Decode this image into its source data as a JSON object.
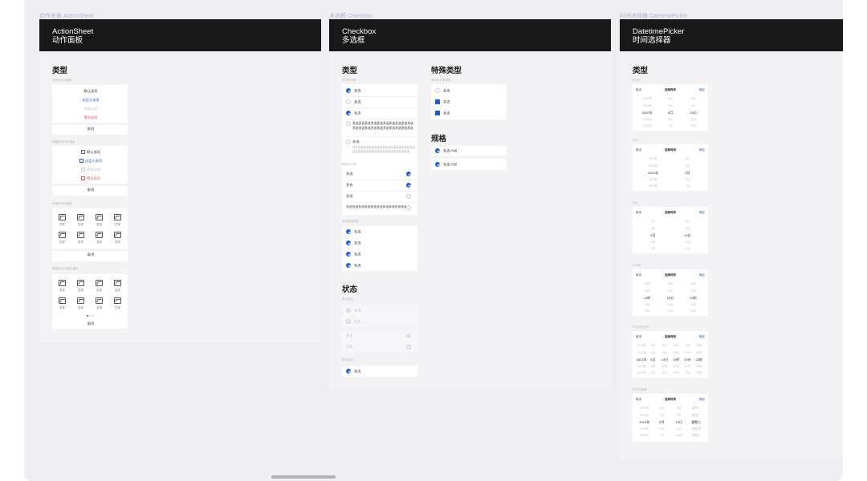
{
  "captions": {
    "actionsheet": "动作面板 ActionSheet",
    "checkbox": "多选框 Checkbox",
    "datetime": "时间选择器 DatetimePicker"
  },
  "actionsheet": {
    "header_en": "ActionSheet",
    "header_cn": "动作面板",
    "section_type": "类型",
    "list_label": "列表型动作面板",
    "list_items": [
      "默认选项",
      "自定义选项",
      "失效选项",
      "警告选项"
    ],
    "cancel": "取消",
    "icon_list_label": "带图标的动作面板",
    "icon_items": [
      "默认选项",
      "自定义选项",
      "失效选项",
      "警告选项"
    ],
    "grid_label": "宫格型动作面板",
    "grid_text": "文字",
    "grid_pager_label": "宫格型动作面板-翻页"
  },
  "checkbox": {
    "header_en": "Checkbox",
    "header_cn": "多选框",
    "section_type": "类型",
    "vertical_label": "纵向多选框",
    "opt": "多选",
    "long_text": "多选多选多选多选多选多选多选多选多选多选多选多选多选多选多选多选多选多选多选多选多选",
    "desc_text": "多选多选多选多选多选多选多选多选多选多选多选多选多选多选多选多选多选多选多选多选多选多选",
    "right_label": "图标在右侧",
    "right_long": "多选多选多选多选多选多选多选多选多选多选多选多选多选多选多选多选多选多选多选多选多选多选",
    "group_label": "多选框选项组",
    "section_status": "状态",
    "disabled_label": "禁用状态",
    "required_label": "默认状态",
    "special_title": "特殊类型",
    "special_label": "纵向卡片多选框",
    "spec_title": "规格",
    "spec_opt": "多选 H48",
    "spec_opt2": "多选 H56"
  },
  "datetime": {
    "header_en": "DatetimePicker",
    "header_cn": "时间选择器",
    "section_type": "类型",
    "cancel": "取消",
    "title": "选择时间",
    "ok": "确定",
    "pickers": [
      {
        "label": "年月日",
        "cols": [
          [
            "2019年",
            "2020年",
            "2021年",
            "2022年",
            "2023年"
          ],
          [
            "3月",
            "4月",
            "5月",
            "6月",
            "7月"
          ],
          [
            "8日",
            "9日",
            "10日",
            "11日",
            "12日"
          ]
        ]
      },
      {
        "label": "年月",
        "cols": [
          [
            "2019年",
            "2020年",
            "2021年",
            "2022年",
            "2023年"
          ],
          [
            "3月",
            "4月",
            "5月",
            "6月",
            "7月"
          ]
        ]
      },
      {
        "label": "月日",
        "cols": [
          [
            "3月",
            "4月",
            "5月",
            "6月",
            "7月"
          ],
          [
            "8日",
            "9日",
            "10日",
            "11日",
            "12日"
          ]
        ]
      },
      {
        "label": "时分秒",
        "cols": [
          [
            "10时",
            "11时",
            "12时",
            "13时",
            "14时"
          ],
          [
            "18分",
            "19分",
            "20分",
            "21分",
            "22分"
          ],
          [
            "20秒",
            "21秒",
            "22秒",
            "23秒",
            "24秒"
          ]
        ]
      },
      {
        "label": "年月日时分秒",
        "cols": [
          [
            "2019年",
            "2020年",
            "2021年",
            "2022年",
            "2023年"
          ],
          [
            "3月",
            "4月",
            "5月",
            "6月",
            "7月"
          ],
          [
            "8日",
            "9日",
            "10日",
            "11日",
            "12日"
          ],
          [
            "10时",
            "11时",
            "12时",
            "13时",
            "14时"
          ],
          [
            "18分",
            "19分",
            "20分",
            "21分",
            "22分"
          ],
          [
            "20秒",
            "21秒",
            "22秒",
            "23秒",
            "24秒"
          ]
        ]
      },
      {
        "label": "年月日星期",
        "cols": [
          [
            "2019年",
            "2020年",
            "2021年",
            "2022年",
            "2023年"
          ],
          [
            "3月",
            "4月",
            "5月",
            "6月",
            "7月"
          ],
          [
            "8日",
            "9日",
            "10日",
            "11日",
            "12日"
          ],
          [
            "星期一",
            "星期二",
            "星期三",
            "星期四",
            "星期五"
          ]
        ]
      }
    ]
  }
}
